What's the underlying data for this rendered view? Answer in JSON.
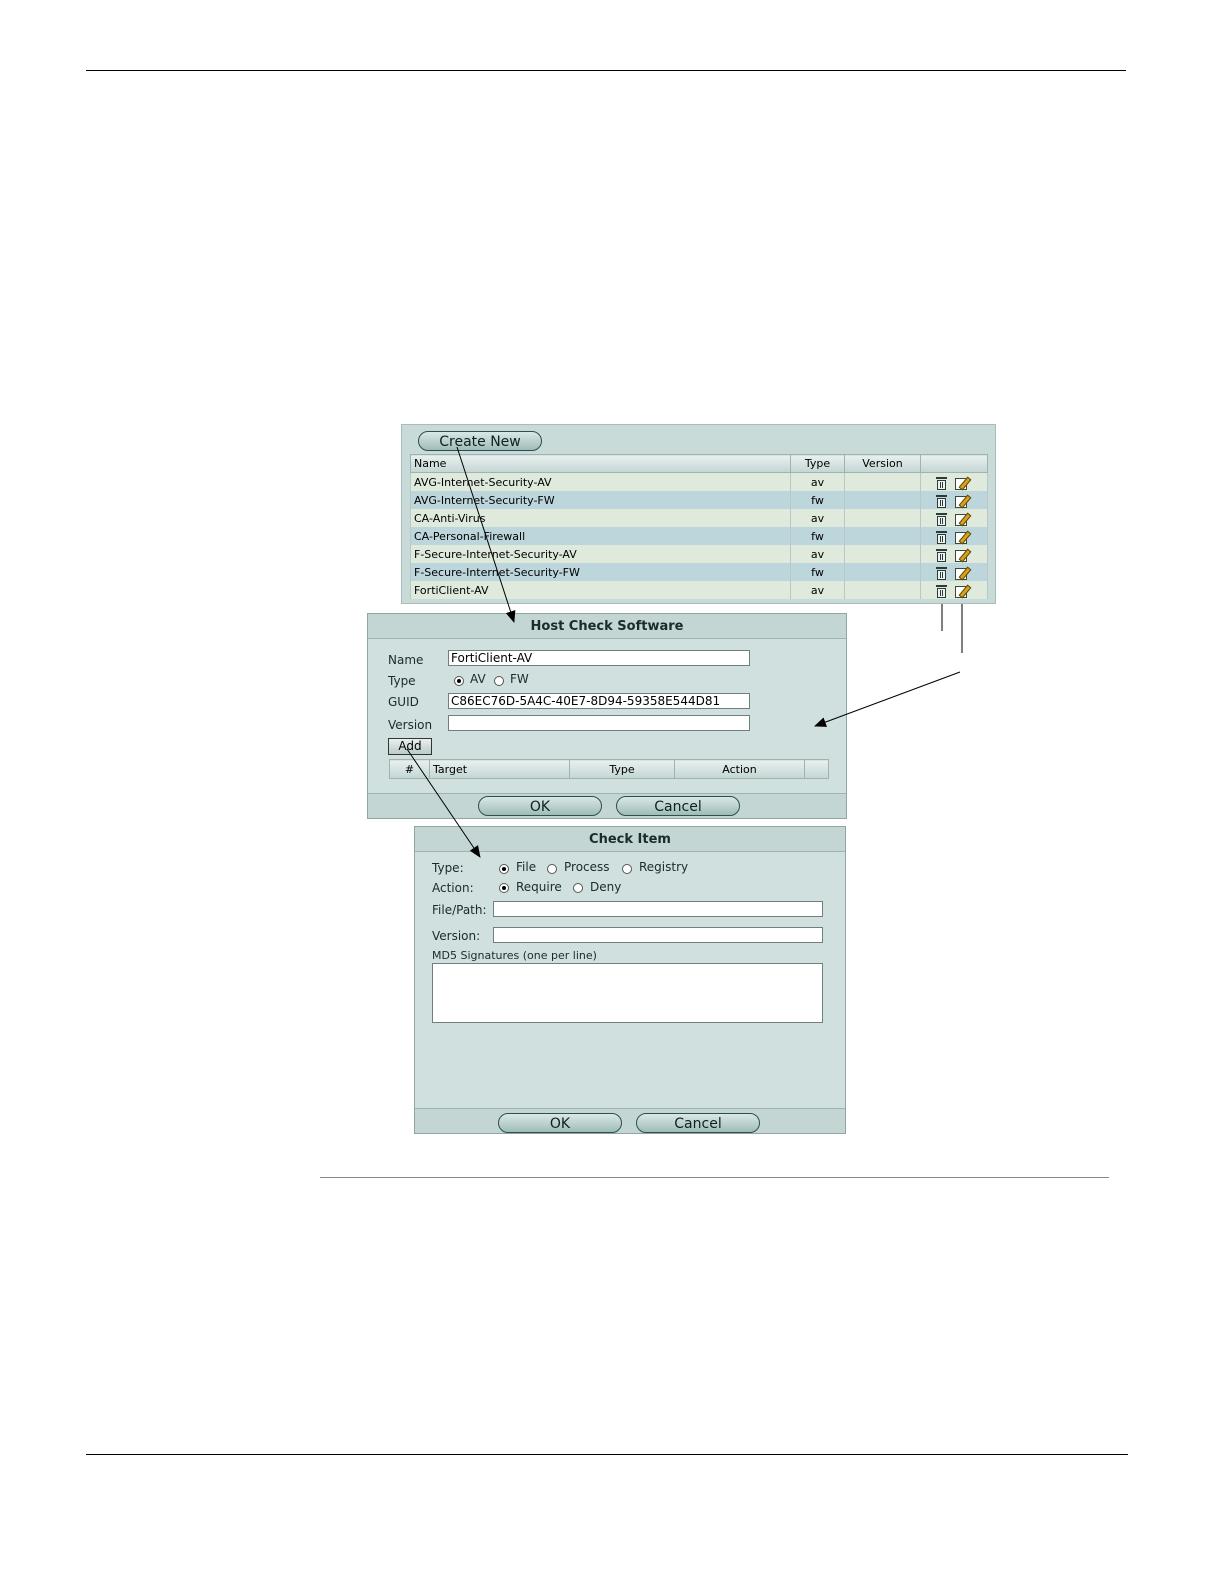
{
  "list_panel": {
    "create_new_label": "Create New",
    "columns": {
      "name": "Name",
      "type": "Type",
      "version": "Version"
    },
    "rows": [
      {
        "name": "AVG-Internet-Security-AV",
        "type": "av",
        "version": ""
      },
      {
        "name": "AVG-Internet-Security-FW",
        "type": "fw",
        "version": ""
      },
      {
        "name": "CA-Anti-Virus",
        "type": "av",
        "version": ""
      },
      {
        "name": "CA-Personal-Firewall",
        "type": "fw",
        "version": ""
      },
      {
        "name": "F-Secure-Internet-Security-AV",
        "type": "av",
        "version": ""
      },
      {
        "name": "F-Secure-Internet-Security-FW",
        "type": "fw",
        "version": ""
      },
      {
        "name": "FortiClient-AV",
        "type": "av",
        "version": ""
      }
    ],
    "row_icons": [
      "delete-icon",
      "edit-icon"
    ]
  },
  "host_check_software": {
    "title": "Host Check Software",
    "name_label": "Name",
    "name_value": "FortiClient-AV",
    "type_label": "Type",
    "type_options": {
      "av": "AV",
      "fw": "FW"
    },
    "type_selected": "AV",
    "guid_label": "GUID",
    "guid_value": "C86EC76D-5A4C-40E7-8D94-59358E544D81",
    "version_label": "Version",
    "version_value": "",
    "add_label": "Add",
    "columns": {
      "num": "#",
      "target": "Target",
      "type": "Type",
      "action": "Action"
    },
    "ok_label": "OK",
    "cancel_label": "Cancel"
  },
  "check_item": {
    "title": "Check Item",
    "type_label": "Type:",
    "type_options": {
      "file": "File",
      "process": "Process",
      "registry": "Registry"
    },
    "type_selected": "File",
    "action_label": "Action:",
    "action_options": {
      "require": "Require",
      "deny": "Deny"
    },
    "action_selected": "Require",
    "filepath_label": "File/Path:",
    "filepath_value": "",
    "version_label": "Version:",
    "version_value": "",
    "md5_label": "MD5 Signatures (one per line)",
    "md5_value": "",
    "ok_label": "OK",
    "cancel_label": "Cancel"
  },
  "colors": {
    "panel_bg": "#cfe0de",
    "row_even": "#dfeadd",
    "row_odd": "#bcd6dc",
    "arrow": "#000000"
  }
}
